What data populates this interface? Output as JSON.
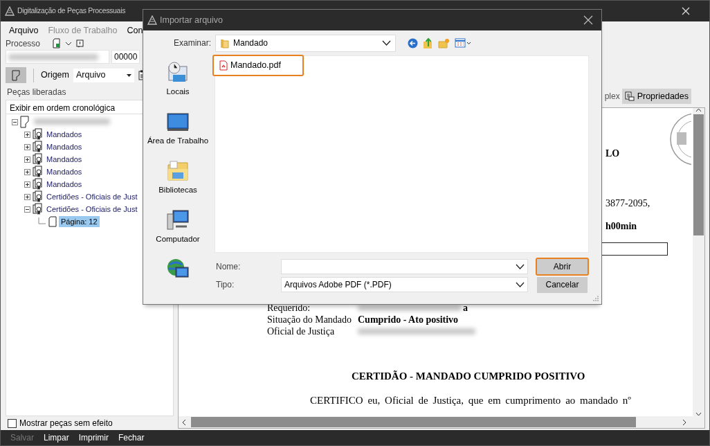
{
  "window": {
    "title": "Digitalização de Peças Processuais"
  },
  "menu": [
    {
      "label": "Arquivo",
      "disabled": false
    },
    {
      "label": "Fluxo de Trabalho",
      "disabled": true
    },
    {
      "label": "Con",
      "disabled": false
    }
  ],
  "process": {
    "label": "Processo",
    "number_suffix": "00000"
  },
  "origin": {
    "label": "Origem",
    "value": "Arquivo"
  },
  "tree": {
    "header": "Peças liberadas",
    "order_label": "Exibir em ordem cronológica",
    "root": {
      "expanded": true,
      "selected": false,
      "children": [
        {
          "label": "Mandados",
          "expanded": false,
          "selected": false
        },
        {
          "label": "Mandados",
          "expanded": false,
          "selected": false
        },
        {
          "label": "Mandados",
          "expanded": false,
          "selected": false
        },
        {
          "label": "Mandados",
          "expanded": false,
          "selected": false
        },
        {
          "label": "Mandados",
          "expanded": false,
          "selected": false
        },
        {
          "label": "Certidões - Oficiais de Just",
          "expanded": false,
          "selected": false
        },
        {
          "label": "Certidões - Oficiais de Just",
          "expanded": true,
          "selected": false,
          "children": [
            {
              "label": "Página: 12",
              "selected": true
            }
          ]
        }
      ]
    }
  },
  "show_void": {
    "label": "Mostrar peças sem efeito",
    "checked": false
  },
  "viewer_tabs": [
    {
      "label": "plex",
      "selected": false
    },
    {
      "label": "Propriedades",
      "selected": true
    }
  ],
  "document": {
    "top_fragments": [
      {
        "text": "LO",
        "bold": true
      },
      {
        "text": "3877-2095,",
        "bold": false
      },
      {
        "text": "h00min",
        "bold": true
      }
    ],
    "fields": [
      {
        "label": "Requerido:",
        "redacted": true,
        "value": "a"
      },
      {
        "label": "Situação do Mandado",
        "redacted": false,
        "value": "Cumprido - Ato positivo"
      },
      {
        "label": "Oficial de Justiça",
        "redacted": true
      }
    ],
    "heading": "CERTIDÃO - MANDADO CUMPRIDO POSITIVO",
    "paragraph": "CERTIFICO eu, Oficial de Justiça, que em cumprimento ao mandado nº"
  },
  "bottom_buttons": [
    {
      "label": "Salvar",
      "disabled": true
    },
    {
      "label": "Limpar",
      "disabled": false
    },
    {
      "label": "Imprimir",
      "disabled": false
    },
    {
      "label": "Fechar",
      "disabled": false
    }
  ],
  "dialog": {
    "title": "Importar arquivo",
    "look_in_label": "Examinar:",
    "look_in_value": "Mandado",
    "places": [
      {
        "kind": "recent",
        "label": "Locais"
      },
      {
        "kind": "desktop",
        "label": "Área de Trabalho"
      },
      {
        "kind": "libraries",
        "label": "Bibliotecas"
      },
      {
        "kind": "computer",
        "label": "Computador"
      },
      {
        "kind": "network"
      }
    ],
    "files": [
      {
        "name": "Mandado.pdf",
        "highlighted": true
      }
    ],
    "name_label": "Nome:",
    "type_label": "Tipo:",
    "type_value": "Arquivos Adobe PDF (*.PDF)",
    "buttons": [
      {
        "label": "Abrir",
        "highlighted": true
      },
      {
        "label": "Cancelar",
        "highlighted": false
      }
    ]
  }
}
